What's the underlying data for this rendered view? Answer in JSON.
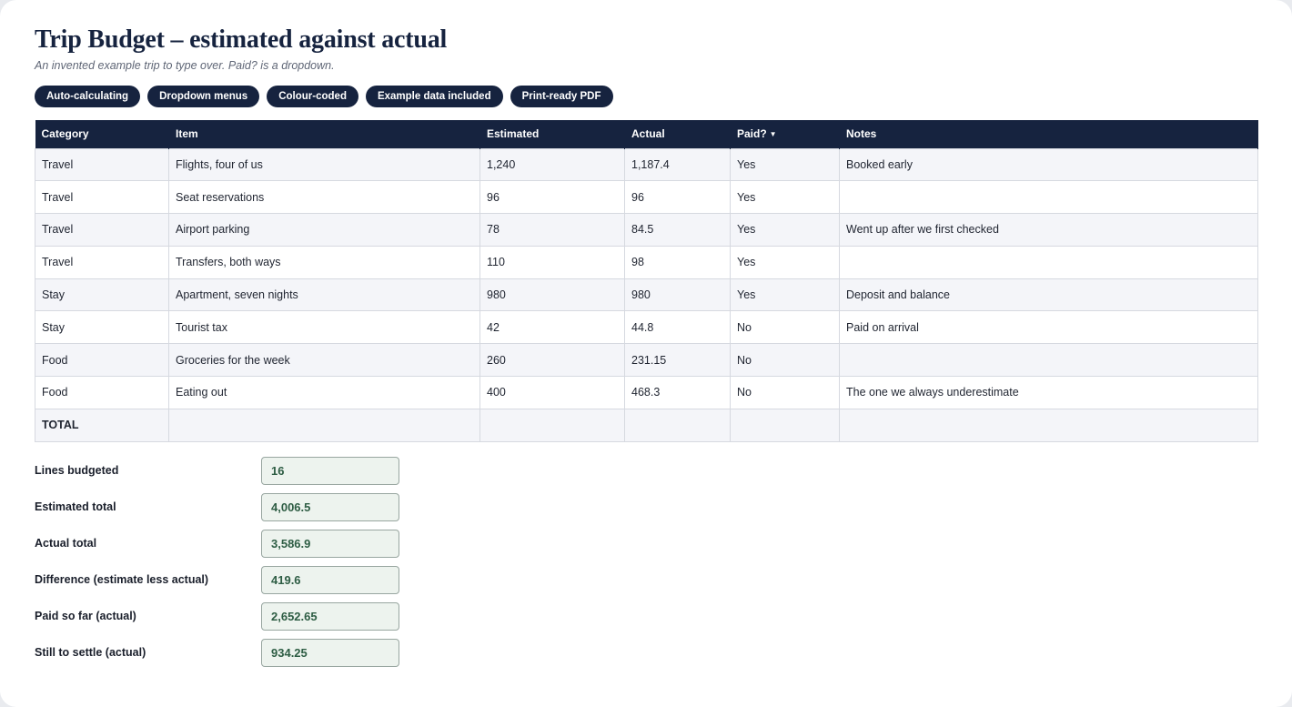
{
  "header": {
    "title": "Trip Budget – estimated against actual",
    "subtitle": "An invented example trip to type over. Paid? is a dropdown."
  },
  "pills": [
    "Auto-calculating",
    "Dropdown menus",
    "Colour-coded",
    "Example data included",
    "Print-ready PDF"
  ],
  "table": {
    "columns": [
      "Category",
      "Item",
      "Estimated",
      "Actual",
      "Paid?",
      "Notes"
    ],
    "paid_caret": "▼",
    "rows": [
      [
        "Travel",
        "Flights, four of us",
        "1,240",
        "1,187.4",
        "Yes",
        "Booked early"
      ],
      [
        "Travel",
        "Seat reservations",
        "96",
        "96",
        "Yes",
        ""
      ],
      [
        "Travel",
        "Airport parking",
        "78",
        "84.5",
        "Yes",
        "Went up after we first checked"
      ],
      [
        "Travel",
        "Transfers, both ways",
        "110",
        "98",
        "Yes",
        ""
      ],
      [
        "Stay",
        "Apartment, seven nights",
        "980",
        "980",
        "Yes",
        "Deposit and balance"
      ],
      [
        "Stay",
        "Tourist tax",
        "42",
        "44.8",
        "No",
        "Paid on arrival"
      ],
      [
        "Food",
        "Groceries for the week",
        "260",
        "231.15",
        "No",
        ""
      ],
      [
        "Food",
        "Eating out",
        "400",
        "468.3",
        "No",
        "The one we always underestimate"
      ]
    ],
    "total_label": "TOTAL"
  },
  "summary": [
    {
      "label": "Lines budgeted",
      "value": "16"
    },
    {
      "label": "Estimated total",
      "value": "4,006.5"
    },
    {
      "label": "Actual total",
      "value": "3,586.9"
    },
    {
      "label": "Difference (estimate less actual)",
      "value": "419.6"
    },
    {
      "label": "Paid so far (actual)",
      "value": "2,652.65"
    },
    {
      "label": "Still to settle (actual)",
      "value": "934.25"
    }
  ],
  "colors": {
    "navy": "#16233f",
    "row_alt": "#f4f5f9",
    "summary_box_bg": "#edf3ee",
    "summary_value": "#2e5d44"
  }
}
